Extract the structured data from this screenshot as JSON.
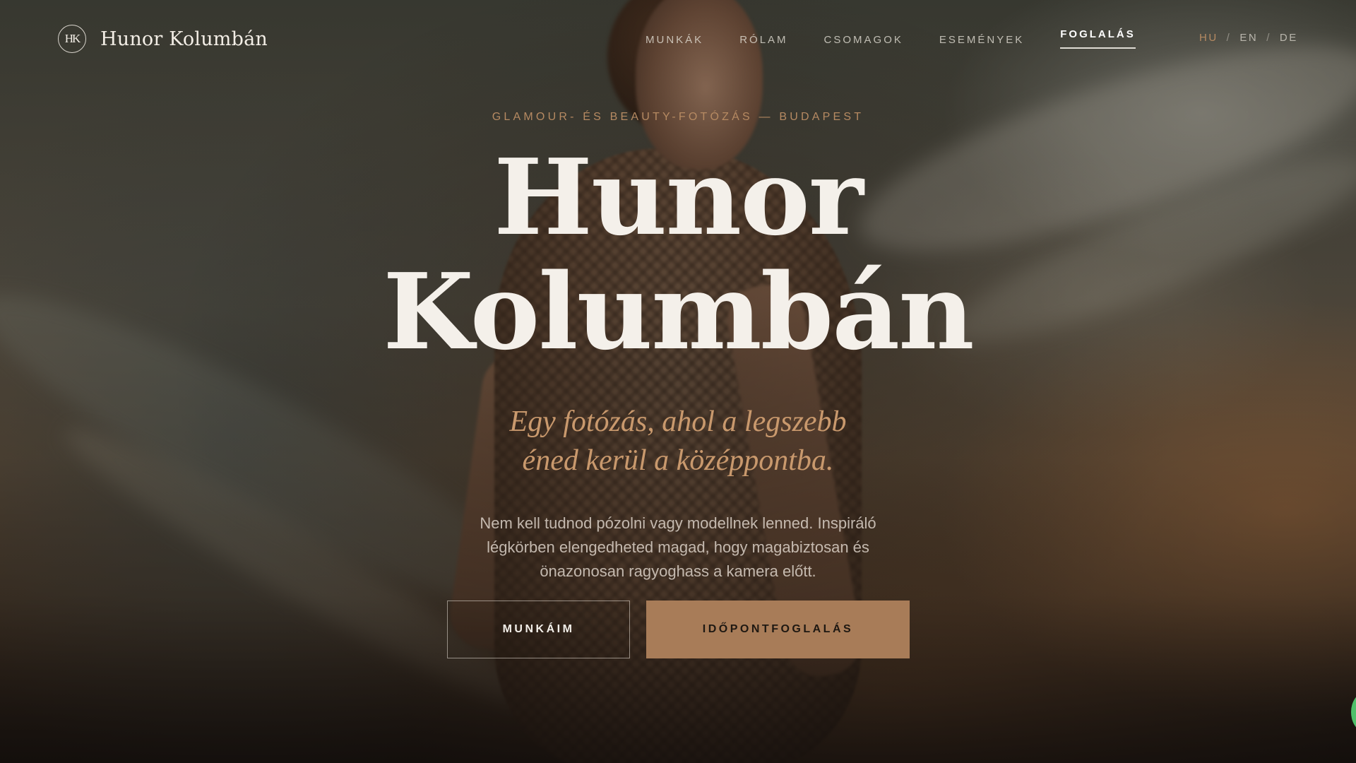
{
  "brand": {
    "monogram": "HK",
    "name": "Hunor Kolumbán"
  },
  "nav": {
    "items": [
      {
        "label": "MUNKÁK"
      },
      {
        "label": "RÓLAM"
      },
      {
        "label": "CSOMAGOK"
      },
      {
        "label": "ESEMÉNYEK"
      },
      {
        "label": "FOGLALÁS",
        "active": true
      }
    ]
  },
  "lang": {
    "items": [
      {
        "label": "HU",
        "current": true
      },
      {
        "label": "EN"
      },
      {
        "label": "DE"
      }
    ],
    "separator": "/"
  },
  "hero": {
    "eyebrow": "GLAMOUR- ÉS BEAUTY-FOTÓZÁS — BUDAPEST",
    "title_line1": "Hunor",
    "title_line2": "Kolumbán",
    "tagline_line1": "Egy fotózás, ahol a legszebb",
    "tagline_line2": "éned kerül a középpontba.",
    "lead": "Nem kell tudnod pózolni vagy modellnek lenned. Inspiráló légkörben elengedheted magad, hogy magabiztosan és önazonosan ragyoghass a kamera előtt.",
    "cta_secondary": "MUNKÁIM",
    "cta_primary": "IDŐPONTFOGLALÁS"
  },
  "colors": {
    "accent": "#b68a62",
    "button_fill": "#a87c58",
    "text_light": "#f4f0ea",
    "chat_widget": "#4fc06a"
  }
}
